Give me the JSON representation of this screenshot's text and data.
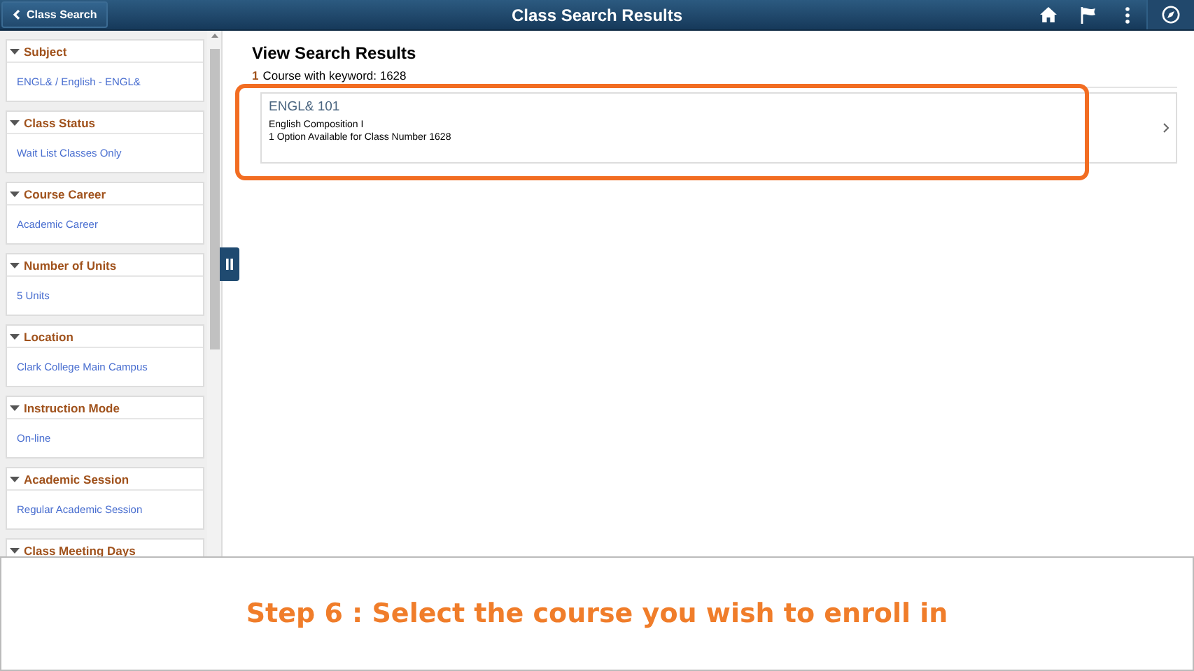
{
  "header": {
    "back_button": "Class Search",
    "title": "Class Search Results"
  },
  "filters": [
    {
      "title": "Subject",
      "value": "ENGL& / English - ENGL&",
      "expanded": true
    },
    {
      "title": "Class Status",
      "value": "Wait List Classes Only",
      "expanded": true
    },
    {
      "title": "Course Career",
      "value": "Academic Career",
      "expanded": true
    },
    {
      "title": "Number of Units",
      "value": "5 Units",
      "expanded": true
    },
    {
      "title": "Location",
      "value": "Clark College Main Campus",
      "expanded": true
    },
    {
      "title": "Instruction Mode",
      "value": "On-line",
      "expanded": true
    },
    {
      "title": "Academic Session",
      "value": "Regular Academic Session",
      "expanded": true
    },
    {
      "title": "Class Meeting Days",
      "expanded": true
    }
  ],
  "results": {
    "heading": "View Search Results",
    "count": "1",
    "summary": "Course with keyword: 1628",
    "courses": [
      {
        "code": "ENGL& 101",
        "name": "English Composition I",
        "options": "1 Option Available for Class Number 1628"
      }
    ]
  },
  "caption": "Step 6 : Select the course you wish to enroll in"
}
